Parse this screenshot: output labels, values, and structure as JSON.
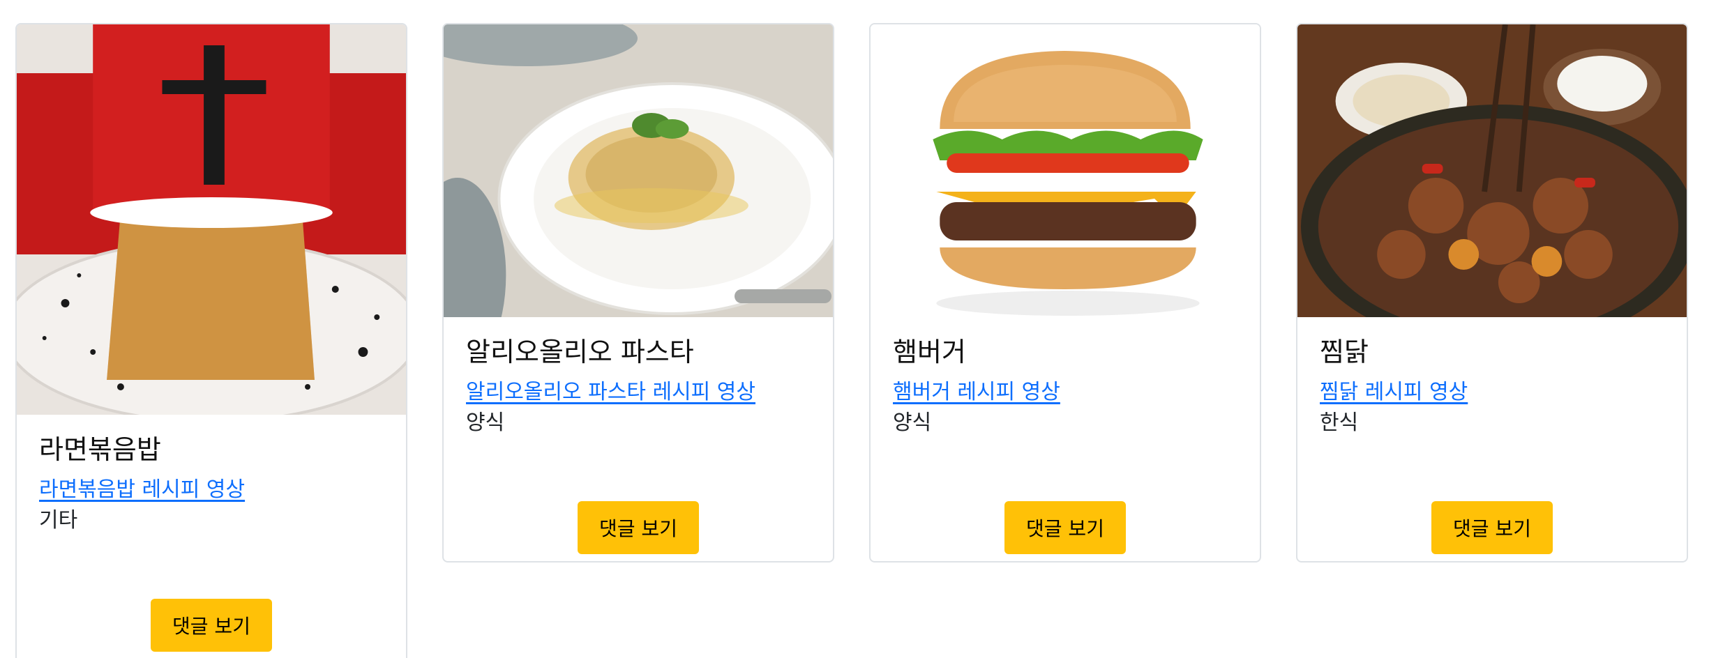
{
  "cards": [
    {
      "title": "라면볶음밥",
      "link_label": "라면볶음밥 레시피 영상",
      "category": "기타",
      "button_label": "댓글 보기"
    },
    {
      "title": "알리오올리오 파스타",
      "link_label": "알리오올리오 파스타 레시피 영상",
      "category": "양식",
      "button_label": "댓글 보기"
    },
    {
      "title": "햄버거",
      "link_label": "햄버거 레시피 영상",
      "category": "양식",
      "button_label": "댓글 보기"
    },
    {
      "title": "찜닭",
      "link_label": "찜닭 레시피 영상",
      "category": "한식",
      "button_label": "댓글 보기"
    }
  ],
  "colors": {
    "link": "#0d6efd",
    "button": "#ffc107",
    "card_border": "#dee2e6"
  }
}
